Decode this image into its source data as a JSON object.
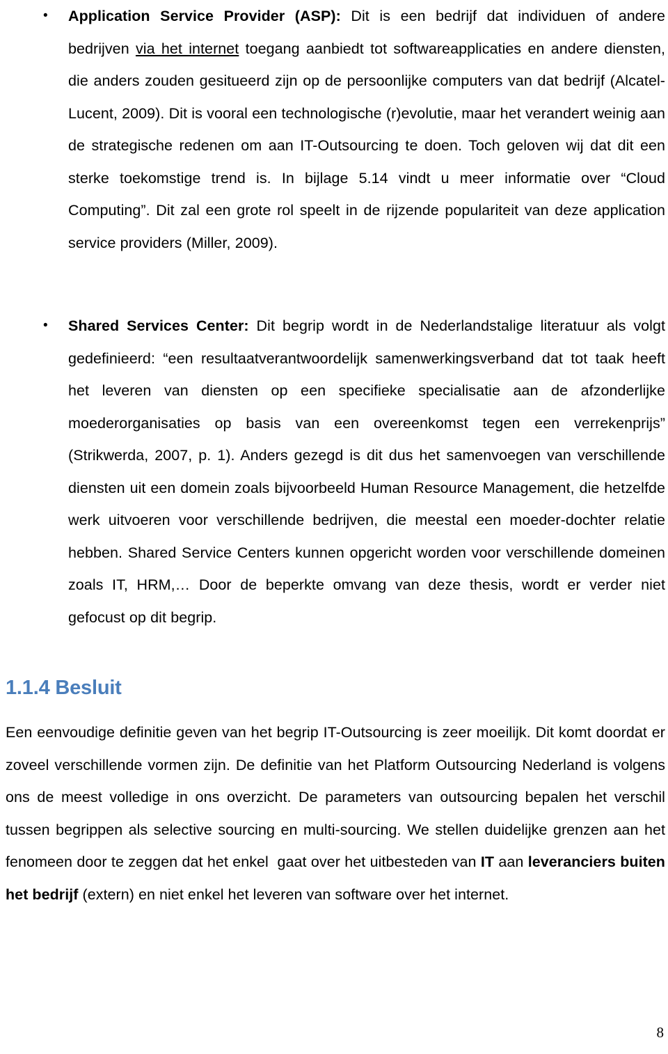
{
  "document": {
    "page_number": "8",
    "heading_color": "#4A7EBB",
    "bullets": [
      {
        "marker": "•",
        "term": "Application Service Provider (ASP):",
        "text_part_1": " Dit is een bedrijf dat individuen of andere bedrijven ",
        "underlined": "via het internet",
        "text_part_2": " toegang aanbiedt tot softwareapplicaties en andere diensten, die anders zouden gesitueerd zijn op de persoonlijke computers van dat bedrijf (Alcatel-Lucent, 2009). Dit is vooral een technologische (r)evolutie, maar het verandert weinig aan de strategische redenen om aan IT-Outsourcing te doen. Toch geloven wij dat dit een sterke toekomstige trend is. In bijlage 5.14 vindt u meer informatie over “Cloud Computing”. Dit zal een grote rol speelt in de rijzende populariteit van deze application service providers (Miller, 2009)."
      },
      {
        "marker": "•",
        "term": "Shared Services Center:",
        "text_part_1": " Dit begrip wordt in de Nederlandstalige literatuur als volgt gedefinieerd: “een resultaatverantwoordelijk samenwerkingsverband dat tot taak heeft het leveren van diensten op een specifieke specialisatie aan de afzonderlijke moederorganisaties op basis van een overeenkomst tegen een verrekenprijs” (Strikwerda, 2007, p. 1). Anders gezegd is dit dus het samenvoegen van verschillende diensten uit een domein zoals bijvoorbeeld Human Resource Management, die hetzelfde werk uitvoeren voor verschillende bedrijven, die meestal een moeder-dochter relatie hebben. Shared Service Centers kunnen opgericht worden voor verschillende domeinen zoals IT, HRM,… Door de beperkte omvang van deze thesis, wordt er verder niet gefocust op dit begrip."
      }
    ],
    "heading": "1.1.4 Besluit",
    "closing_paragraph": {
      "part_1": "Een eenvoudige definitie geven van het begrip IT-Outsourcing is zeer moeilijk. Dit komt doordat er zoveel verschillende vormen zijn. De definitie van het Platform Outsourcing Nederland is volgens ons de meest volledige in ons overzicht. De parameters van outsourcing bepalen het verschil tussen begrippen als selective sourcing en multi-sourcing. We stellen duidelijke grenzen aan het fenomeen door te zeggen dat het enkel  gaat over het uitbesteden van ",
      "bold_1": "IT",
      "part_2": " aan ",
      "bold_2": "leveranciers buiten het bedrijf",
      "part_3": " (extern) en niet enkel het leveren van software over het internet."
    }
  }
}
